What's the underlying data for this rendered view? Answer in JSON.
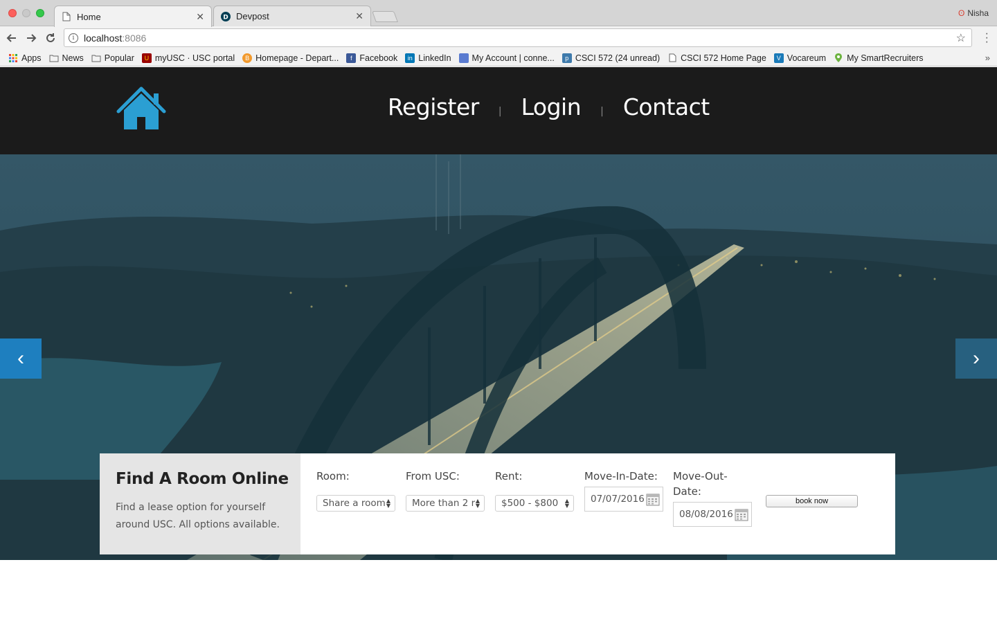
{
  "browser": {
    "tabs": [
      {
        "title": "Home",
        "active": true
      },
      {
        "title": "Devpost",
        "active": false
      }
    ],
    "profile_name": "Nisha",
    "url_host": "localhost",
    "url_port": ":8086",
    "bookmarks": [
      {
        "label": "Apps",
        "icon": "apps-grid-icon"
      },
      {
        "label": "News",
        "icon": "folder-icon"
      },
      {
        "label": "Popular",
        "icon": "folder-icon"
      },
      {
        "label": "myUSC · USC portal",
        "icon": "usc-icon"
      },
      {
        "label": "Homepage - Depart...",
        "icon": "bitcoin-icon"
      },
      {
        "label": "Facebook",
        "icon": "facebook-icon"
      },
      {
        "label": "LinkedIn",
        "icon": "linkedin-icon"
      },
      {
        "label": "My Account | conne...",
        "icon": "account-icon"
      },
      {
        "label": "CSCI 572 (24 unread)",
        "icon": "piazza-icon"
      },
      {
        "label": "CSCI 572 Home Page",
        "icon": "page-icon"
      },
      {
        "label": "Vocareum",
        "icon": "vocareum-icon"
      },
      {
        "label": "My SmartRecruiters",
        "icon": "smartrecruiters-icon"
      }
    ]
  },
  "header": {
    "nav": {
      "register": "Register",
      "login": "Login",
      "contact": "Contact",
      "separator": "|"
    },
    "colors": {
      "logo": "#2b9fd3",
      "background": "#1b1b1b"
    }
  },
  "hero": {
    "prev_arrow": "‹",
    "next_arrow": "›"
  },
  "search": {
    "title": "Find A Room Online",
    "description": "Find a lease option for yourself around USC. All options available.",
    "room": {
      "label": "Room:",
      "value": "Share a room"
    },
    "distance": {
      "label": "From USC:",
      "value": "More than 2 r"
    },
    "rent": {
      "label": "Rent:",
      "value": "$500 - $800"
    },
    "move_in": {
      "label": "Move-In-Date:",
      "value": "07/07/2016"
    },
    "move_out": {
      "label": "Move-Out-Date:",
      "value": "08/08/2016"
    },
    "book_button": "book now"
  }
}
